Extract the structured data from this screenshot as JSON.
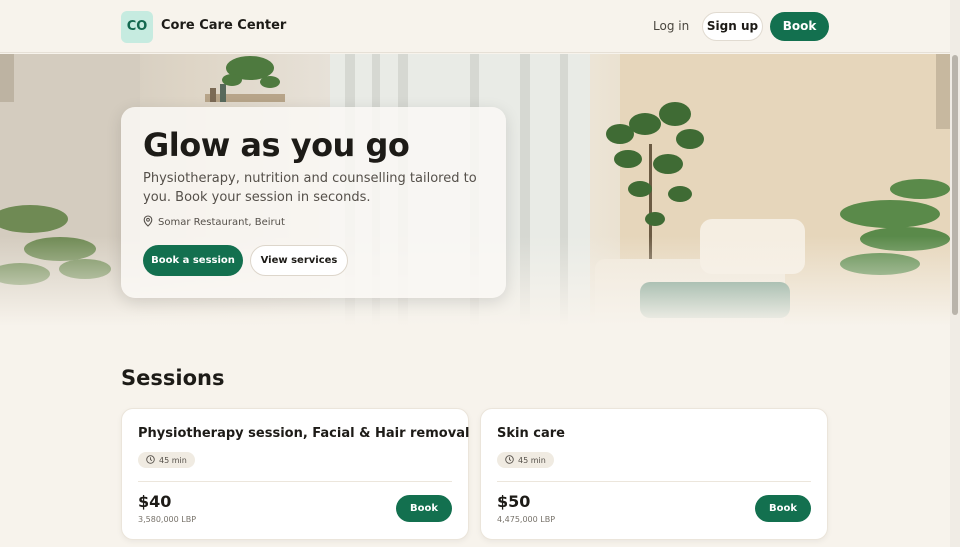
{
  "header": {
    "logo_text": "CO",
    "brand": "Core Care Center",
    "login": "Log in",
    "signup": "Sign up",
    "book": "Book"
  },
  "hero": {
    "title": "Glow as you go",
    "subtitle": "Physiotherapy, nutrition and counselling tailored to you. Book your session in seconds.",
    "location": "Somar Restaurant, Beirut",
    "primary_cta": "Book a session",
    "secondary_cta": "View services"
  },
  "sessions": {
    "title": "Sessions",
    "items": [
      {
        "name": "Physiotherapy session, Facial & Hair removal",
        "duration": "45 min",
        "price": "$40",
        "price_lbp": "3,580,000 LBP",
        "book": "Book"
      },
      {
        "name": "Skin care",
        "duration": "45 min",
        "price": "$50",
        "price_lbp": "4,475,000 LBP",
        "book": "Book"
      }
    ]
  },
  "colors": {
    "accent": "#13704f",
    "background": "#f7f3ec",
    "logo_bg": "#c6ebe0"
  }
}
